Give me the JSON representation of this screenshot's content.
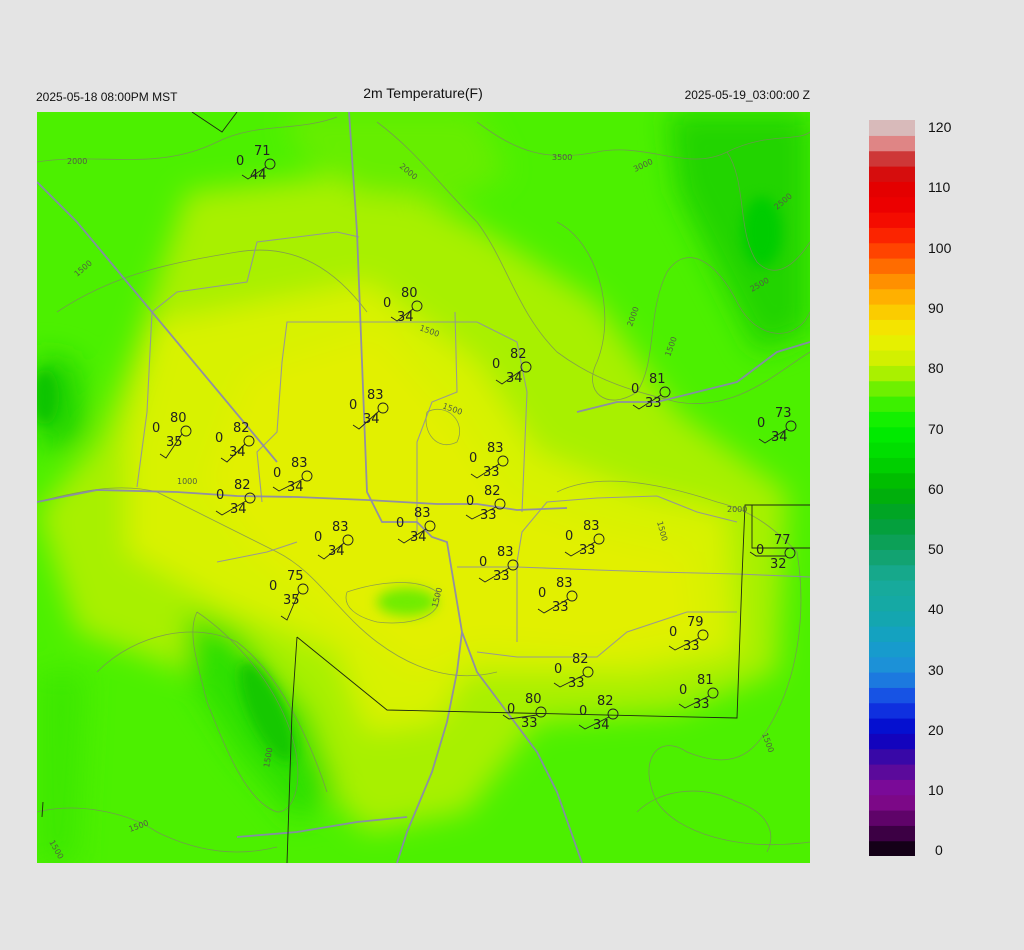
{
  "header": {
    "left": "2025-05-18 08:00PM MST",
    "title": "2m Temperature(F)",
    "right": "2025-05-19_03:00:00 Z"
  },
  "colorbar": {
    "labels": [
      "120",
      "110",
      "100",
      "90",
      "80",
      "70",
      "60",
      "50",
      "40",
      "30",
      "20",
      "10",
      "0"
    ],
    "stops": [
      {
        "v": 0,
        "c": "#000000"
      },
      {
        "v": 5,
        "c": "#50005a"
      },
      {
        "v": 10,
        "c": "#8a0a96"
      },
      {
        "v": 15,
        "c": "#4b0a9c"
      },
      {
        "v": 20,
        "c": "#0000c8"
      },
      {
        "v": 25,
        "c": "#1440e6"
      },
      {
        "v": 30,
        "c": "#1e8cdc"
      },
      {
        "v": 35,
        "c": "#14a0c8"
      },
      {
        "v": 40,
        "c": "#14a8a8"
      },
      {
        "v": 45,
        "c": "#18aa98"
      },
      {
        "v": 50,
        "c": "#10a064"
      },
      {
        "v": 55,
        "c": "#00a030"
      },
      {
        "v": 60,
        "c": "#00b400"
      },
      {
        "v": 65,
        "c": "#00d800"
      },
      {
        "v": 70,
        "c": "#00f000"
      },
      {
        "v": 75,
        "c": "#50f000"
      },
      {
        "v": 80,
        "c": "#c8f000"
      },
      {
        "v": 85,
        "c": "#f0f000"
      },
      {
        "v": 90,
        "c": "#ffc000"
      },
      {
        "v": 95,
        "c": "#ff8000"
      },
      {
        "v": 100,
        "c": "#ff3000"
      },
      {
        "v": 105,
        "c": "#f00000"
      },
      {
        "v": 110,
        "c": "#e00000"
      },
      {
        "v": 113,
        "c": "#c81e1e"
      },
      {
        "v": 116,
        "c": "#e08080"
      },
      {
        "v": 120,
        "c": "#d4d4d4"
      }
    ]
  },
  "contour_labels": [
    "2000",
    "1500",
    "1000",
    "3500",
    "3000",
    "2500",
    "2000",
    "2000",
    "1500",
    "1500",
    "1500",
    "2000",
    "1500",
    "2500",
    "1500",
    "1500",
    "1500",
    "1500",
    "1500"
  ],
  "stations": [
    {
      "t": "71",
      "c": "0",
      "d": "44"
    },
    {
      "t": "80",
      "c": "0",
      "d": "34"
    },
    {
      "t": "82",
      "c": "0",
      "d": "34"
    },
    {
      "t": "81",
      "c": "0",
      "d": "33"
    },
    {
      "t": "83",
      "c": "0",
      "d": "34"
    },
    {
      "t": "80",
      "c": "0",
      "d": "35"
    },
    {
      "t": "82",
      "c": "0",
      "d": "34"
    },
    {
      "t": "83",
      "c": "0",
      "d": "33"
    },
    {
      "t": "73",
      "c": "0",
      "d": "34"
    },
    {
      "t": "83",
      "c": "0",
      "d": "34"
    },
    {
      "t": "82",
      "c": "0",
      "d": "34"
    },
    {
      "t": "82",
      "c": "0",
      "d": "33"
    },
    {
      "t": "83",
      "c": "0",
      "d": "34"
    },
    {
      "t": "83",
      "c": "0",
      "d": "33"
    },
    {
      "t": "83",
      "c": "0",
      "d": "34"
    },
    {
      "t": "82",
      "c": "0",
      "d": "34"
    },
    {
      "t": "77",
      "c": "0",
      "d": "32"
    },
    {
      "t": "83",
      "c": "0",
      "d": "33"
    },
    {
      "t": "75",
      "c": "0",
      "d": "35"
    },
    {
      "t": "83",
      "c": "0",
      "d": "33"
    },
    {
      "t": "79",
      "c": "0",
      "d": "33"
    },
    {
      "t": "82",
      "c": "0",
      "d": "33"
    },
    {
      "t": "81",
      "c": "0",
      "d": "33"
    },
    {
      "t": "80",
      "c": "0",
      "d": "33"
    }
  ]
}
